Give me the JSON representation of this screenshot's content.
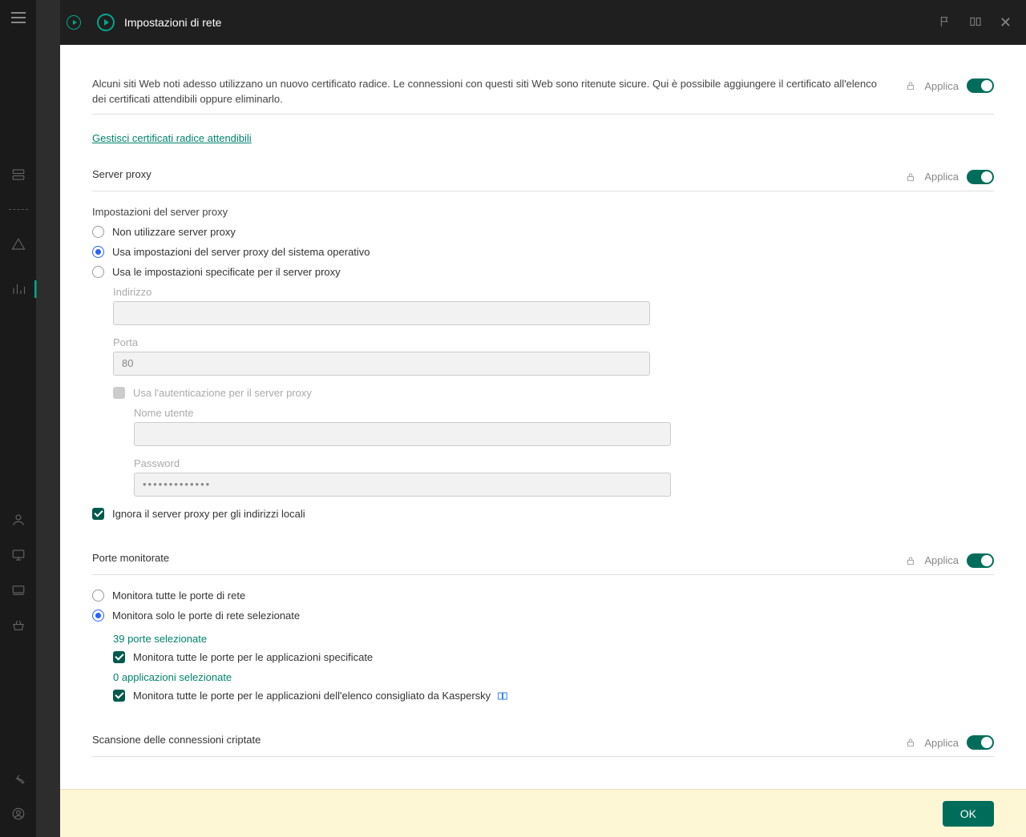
{
  "header": {
    "title": "Impostazioni di rete"
  },
  "applica_label": "Applica",
  "cert_section": {
    "intro": "Alcuni siti Web noti adesso utilizzano un nuovo certificato radice. Le connessioni con questi siti Web sono ritenute sicure. Qui è possibile aggiungere il certificato all'elenco dei certificati attendibili oppure eliminarlo.",
    "manage_link": "Gestisci certificati radice attendibili"
  },
  "proxy": {
    "title": "Server proxy",
    "settings_label": "Impostazioni del server proxy",
    "opt_none": "Non utilizzare server proxy",
    "opt_os": "Usa impostazioni del server proxy del sistema operativo",
    "opt_manual": "Usa le impostazioni specificate per il server proxy",
    "address_label": "Indirizzo",
    "address_value": "",
    "port_label": "Porta",
    "port_value": "80",
    "auth_label": "Usa l'autenticazione per il server proxy",
    "user_label": "Nome utente",
    "user_value": "",
    "password_label": "Password",
    "password_value": "•••••••••••••",
    "bypass_local": "Ignora il server proxy per gli indirizzi locali"
  },
  "ports": {
    "title": "Porte monitorate",
    "opt_all": "Monitora tutte le porte di rete",
    "opt_selected": "Monitora solo le porte di rete selezionate",
    "selected_link": "39 porte selezionate",
    "chk_apps": "Monitora tutte le porte per le applicazioni specificate",
    "apps_link": "0 applicazioni selezionate",
    "chk_kaspersky": "Monitora tutte le porte per le applicazioni dell'elenco consigliato da Kaspersky"
  },
  "encrypted": {
    "title": "Scansione delle connessioni criptate"
  },
  "footer": {
    "ok": "OK"
  }
}
